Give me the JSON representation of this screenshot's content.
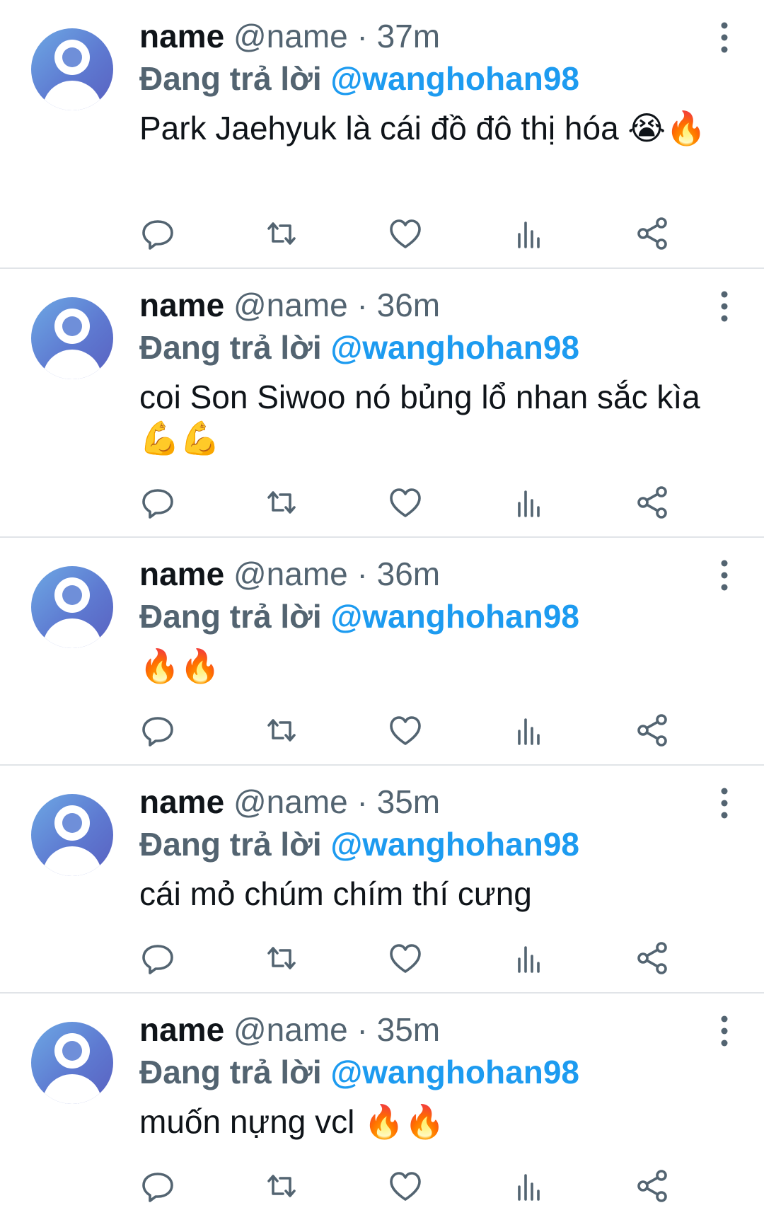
{
  "tweets": [
    {
      "name": "name",
      "handle": "@name",
      "separator": "·",
      "time": "37m",
      "reply_prefix": "Đang trả lời",
      "reply_to": "@wanghohan98",
      "text": "Park Jaehyuk là cái đồ đô thị hóa 😭🔥"
    },
    {
      "name": "name",
      "handle": "@name",
      "separator": "·",
      "time": "36m",
      "reply_prefix": "Đang trả lời",
      "reply_to": "@wanghohan98",
      "text": "coi Son Siwoo nó bủng lổ nhan sắc kìa 💪💪"
    },
    {
      "name": "name",
      "handle": "@name",
      "separator": "·",
      "time": "36m",
      "reply_prefix": "Đang trả lời",
      "reply_to": "@wanghohan98",
      "text": "🔥🔥"
    },
    {
      "name": "name",
      "handle": "@name",
      "separator": "·",
      "time": "35m",
      "reply_prefix": "Đang trả lời",
      "reply_to": "@wanghohan98",
      "text": "cái mỏ chúm chím thí cưng"
    },
    {
      "name": "name",
      "handle": "@name",
      "separator": "·",
      "time": "35m",
      "reply_prefix": "Đang trả lời",
      "reply_to": "@wanghohan98",
      "text": "muốn nựng vcl 🔥🔥"
    }
  ],
  "icons": {
    "reply": "comment-icon",
    "retweet": "retweet-icon",
    "like": "heart-icon",
    "views": "bar-chart-icon",
    "share": "share-icon",
    "more": "more-vertical-icon",
    "avatar": "default-avatar-icon"
  },
  "colors": {
    "mention": "#1d9bf0",
    "secondary_text": "#536471",
    "primary_text": "#0f1419",
    "divider": "#e1e4e8"
  }
}
